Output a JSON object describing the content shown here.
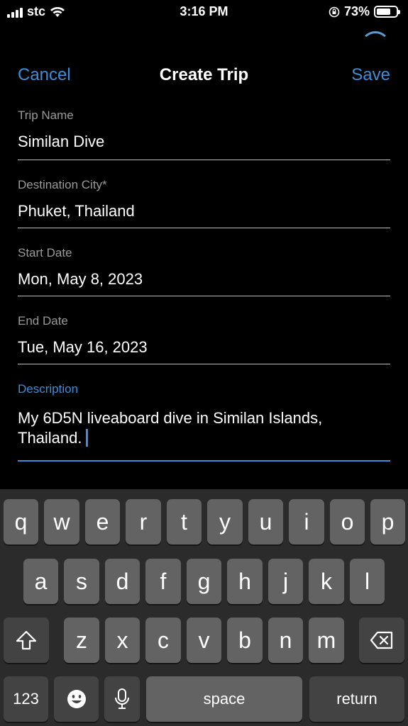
{
  "status_bar": {
    "carrier": "stc",
    "time": "3:16 PM",
    "battery_percent": "73%",
    "battery_level": 0.73
  },
  "nav": {
    "cancel_label": "Cancel",
    "title": "Create Trip",
    "save_label": "Save"
  },
  "form": {
    "trip_name": {
      "label": "Trip Name",
      "value": "Similan Dive"
    },
    "destination": {
      "label": "Destination City*",
      "value": "Phuket, Thailand"
    },
    "start_date": {
      "label": "Start Date",
      "value": "Mon, May 8, 2023"
    },
    "end_date": {
      "label": "End Date",
      "value": "Tue, May 16, 2023"
    },
    "description": {
      "label": "Description",
      "value_line1": "My 6D5N liveaboard dive in Similan Islands,",
      "value_line2": "Thailand."
    }
  },
  "keyboard": {
    "row1": [
      "q",
      "w",
      "e",
      "r",
      "t",
      "y",
      "u",
      "i",
      "o",
      "p"
    ],
    "row2": [
      "a",
      "s",
      "d",
      "f",
      "g",
      "h",
      "j",
      "k",
      "l"
    ],
    "row3": [
      "z",
      "x",
      "c",
      "v",
      "b",
      "n",
      "m"
    ],
    "numbers_label": "123",
    "space_label": "space",
    "return_label": "return",
    "icons": {
      "shift": "shift-icon",
      "backspace": "backspace-icon",
      "emoji": "emoji-icon",
      "mic": "microphone-icon"
    }
  },
  "colors": {
    "accent": "#3a8fd9",
    "background": "#000000",
    "keyboard_bg": "#2b2b2b",
    "key": "#636363",
    "key_dark": "#434343"
  }
}
